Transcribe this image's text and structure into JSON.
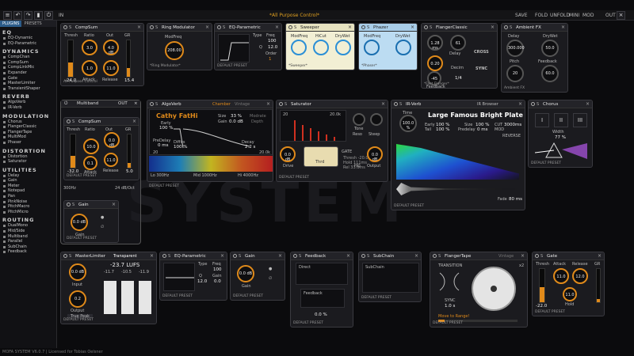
{
  "topbar": {
    "preset_title": "*All Purpose Control*",
    "in_label": "IN",
    "save": "SAVE",
    "fold": "FOLD",
    "unfold": "UNFOLD",
    "mini": "MINI",
    "mod": "MOD",
    "out": "OUT"
  },
  "sidebar": {
    "tabs": [
      "PLUGINS",
      "PRESETS"
    ],
    "categories": [
      {
        "name": "EQ",
        "items": [
          "EQ-Dynamic",
          "EQ-Parametric"
        ]
      },
      {
        "name": "DYNAMICS",
        "items": [
          "CompChan",
          "CompSum",
          "CompLinkMic",
          "Expander",
          "Gate",
          "MasterLimiter",
          "TransientShaper"
        ]
      },
      {
        "name": "REVERB",
        "items": [
          "AlgoVerb",
          "IR-Verb"
        ]
      },
      {
        "name": "MODULATION",
        "items": [
          "Chorus",
          "FlangerClassic",
          "FlangerTape",
          "MultiMod",
          "Phaser"
        ]
      },
      {
        "name": "DISTORTION",
        "items": [
          "Distortion",
          "Saturator"
        ]
      },
      {
        "name": "UTILITIES",
        "items": [
          "Delay",
          "Gain",
          "Meter",
          "Notepad",
          "Pan",
          "PinkNoise",
          "PitchMacro",
          "PitchMicro"
        ]
      },
      {
        "name": "ROUTING",
        "items": [
          "DualMono",
          "Mid/Side",
          "Multiband",
          "Parallel",
          "SubChain",
          "Feedback"
        ]
      }
    ]
  },
  "mods": {
    "compsum1": {
      "title": "CompSum",
      "thresh": "Thresh",
      "ratio": "Ratio",
      "out": "Out",
      "gr": "GR",
      "ratio_val": "3.0",
      "out_val": "4.0 dB",
      "attack_val": "1.0",
      "release_val": "11.0",
      "attack": "Attack",
      "release": "Release",
      "thresh_val": "-24.0",
      "gr_val": "15.4",
      "footer": "All Purpose Control"
    },
    "ringmod": {
      "title": "Ring Modulator",
      "modfreq": "ModFreq",
      "modfreq_val": "208.00",
      "footer": "*Ring Modulator*"
    },
    "eqparam": {
      "title": "EQ-Parametric",
      "type": "Type",
      "freq": "Freq",
      "q": "Q",
      "order": "Order",
      "freq_val": "100",
      "q_val": "12.0",
      "order_val": "1",
      "footer": "DEFAULT PRESET"
    },
    "sweeper": {
      "title": "Sweeper",
      "modfreq": "ModFreq",
      "hicut": "HiCut",
      "drywet": "DryWet",
      "footer": "*Sweeper*"
    },
    "phazer": {
      "title": "Phazer",
      "modfreq": "ModFreq",
      "drywet": "DryWet",
      "footer": "*Phaser*"
    },
    "flanger": {
      "title": "FlangerClassic",
      "delay_val": "1.28 ms",
      "mod_val": "61",
      "dry_val": "0.20",
      "sec_val": "-45",
      "feedback": "Feedback",
      "delay": "Delay",
      "decim": "Decim",
      "cross": "CROSS",
      "sync": "SYNC",
      "rate_val": "1/4",
      "footer": "*Fast Flanger*"
    },
    "ambient": {
      "title": "Ambient FX",
      "delay": "Delay",
      "drywet": "DryWet",
      "delay_val": "300.000",
      "drywet_val": "50.0",
      "pitch": "Pitch",
      "feedback": "Feedback",
      "pitch_val": "20",
      "feedback_val": "60.0",
      "footer": "Ambient FX"
    },
    "multiband": {
      "title": "Multiband",
      "out": "OUT",
      "freq_low": "300Hz",
      "freq_high": "24 dB/Oct"
    },
    "compsum2": {
      "title": "CompSum",
      "thresh": "Thresh",
      "ratio": "Ratio",
      "out": "Out",
      "gr": "GR",
      "out_val": "0.0 dB",
      "ratio_val": "10.0",
      "attack_val": "0.1",
      "release_val": "11.0",
      "attack": "Attack",
      "release": "Release",
      "thresh_val": "-32.0",
      "gr_val": "5.0",
      "footer": "DEFAULT PRESET"
    },
    "gain1": {
      "title": "Gain",
      "dual": "Dual",
      "gain_val": "0.0 dB",
      "gain": "Gain",
      "footer": "DEFAULT PRESET"
    },
    "algoverb": {
      "title": "AlgoVerb",
      "chamber": "Chamber",
      "vintage": "Vintage",
      "preset": "Cathy FatHi",
      "size": "Size",
      "size_val": "33 %",
      "gain": "Gain",
      "gain_val": "0.0 dB",
      "early": "Early",
      "early_val": "100 %",
      "predelay": "PreDelay",
      "predelay_val": "0 ms",
      "diffus": "Diffus",
      "diffus_val": "100 %",
      "decay": "Decay",
      "decay_val": "2.2 s",
      "modrate": "Modrate",
      "depth": "Depth",
      "lo": "Lo 300Hz",
      "mid": "Mid 1000Hz",
      "hi": "Hi 4000Hz",
      "hz20": "20",
      "hz20k": "20.0k",
      "footer": "DEFAULT PRESET"
    },
    "saturator": {
      "title": "Saturator",
      "hz20": "20",
      "hz20k": "20.0k",
      "drive": "Drive",
      "drive_val": "0.0 dB",
      "tone": "Tone",
      "reso": "Reso",
      "steep": "Steep",
      "thrd": "Thrd",
      "hq": "HQ",
      "output": "Output",
      "output_val": "0.0 dB",
      "gate": "GATE",
      "thresh": "Thresh -20.0dB",
      "hold": "Hold 111ms",
      "rel": "Rel 33.0ms",
      "footer": "DEFAULT PRESET"
    },
    "irverb": {
      "title": "IR-Verb",
      "browser": "IR Browser",
      "preset": "Large Famous Bright Plate",
      "time": "Time",
      "time_val": "100.0 %",
      "early": "Early",
      "early_val": "100 %",
      "tail": "Tail",
      "tail_val": "100 %",
      "size": "Size",
      "size_val": "100 %",
      "predelay": "Predelay",
      "predelay_val": "0 ms",
      "cut": "CUT",
      "cut_val": "3000ms",
      "mod": "MOD",
      "reverse": "REVERSE",
      "fade": "Fade",
      "fade_val": "80 ms",
      "footer": "DEFAULT PRESET"
    },
    "chorus": {
      "title": "Chorus",
      "width": "Width",
      "width_val": "77 %",
      "buttons": [
        "I",
        "II",
        "III"
      ],
      "footer": "DEFAULT PRESET"
    },
    "masterlim": {
      "title": "MasterLimiter",
      "transparent": "Transparent",
      "lufs": "-23.7 LUFS",
      "l1": "-11.7",
      "l2": "-10.5",
      "l3": "-11.9",
      "input": "Input",
      "input_val": "0.0 dB",
      "output": "Output",
      "output_val": "0.2",
      "peak": "True Peak",
      "footer": "DEFAULT PRESET"
    },
    "eqparam2": {
      "title": "EQ-Parametric",
      "type": "Type",
      "freq": "Freq",
      "q": "Q",
      "gain": "Gain",
      "freq_val": "100",
      "q_val": "12.0",
      "gain_val": "0.0",
      "footer": "DEFAULT PRESET"
    },
    "gain2": {
      "title": "Gain",
      "dual": "Dual",
      "gain_val": "0.0 dB",
      "gain": "Gain",
      "footer": "DEFAULT PRESET"
    },
    "feedback": {
      "title": "Feedback",
      "direct": "Direct",
      "feedback": "Feedback",
      "pct": "0.0 %",
      "footer": "DEFAULT PRESET"
    },
    "subchain": {
      "title": "SubChain",
      "sub": "SubChain",
      "footer": "DEFAULT PRESET"
    },
    "flangertape": {
      "title": "FlangerTape",
      "vintage": "Vintage",
      "transition": "TRANSITION",
      "sync": "SYNC",
      "sync_val": "1.0 s",
      "move": "Move to Range!",
      "x2": "x2",
      "footer": "DEFAULT PRESET"
    },
    "gate": {
      "title": "Gate",
      "thresh": "Thresh",
      "attack": "Attack",
      "release": "Release",
      "gr": "GR",
      "attack_val": "11.0",
      "release_val": "12.0",
      "thresh_val": "-22.0",
      "hold_val": "11.0",
      "hold": "Hold",
      "footer": "DEFAULT PRESET"
    }
  },
  "bgtext": "SYSTEM",
  "status": "MOFA SYSTEM V6.0.7 | Licensed for Tobias Oelsner"
}
